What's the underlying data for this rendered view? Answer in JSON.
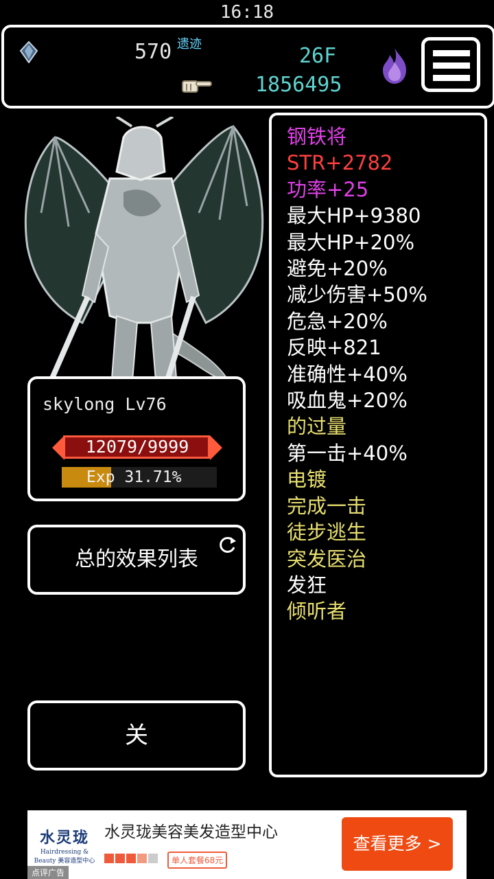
{
  "status_bar": {
    "time": "16:18"
  },
  "top_bar": {
    "gold": "570",
    "relic_label": "遗迹",
    "floor": "26F",
    "score": "1856495"
  },
  "character": {
    "name_level": "skylong Lv76",
    "hp_text": "12079/9999",
    "exp_text": "Exp 31.71%",
    "exp_fraction": 0.3171
  },
  "buttons": {
    "effects_list": "总的效果列表",
    "close": "关"
  },
  "stats": [
    {
      "text": "钢铁将",
      "color": "#e040e8"
    },
    {
      "text": "STR+2782",
      "color": "#ff4040"
    },
    {
      "text": "功率+25",
      "color": "#e040e8"
    },
    {
      "text": "最大HP+9380",
      "color": "#ffffff"
    },
    {
      "text": "最大HP+20%",
      "color": "#ffffff"
    },
    {
      "text": "避免+20%",
      "color": "#ffffff"
    },
    {
      "text": "减少伤害+50%",
      "color": "#ffffff"
    },
    {
      "text": "危急+20%",
      "color": "#ffffff"
    },
    {
      "text": "反映+821",
      "color": "#ffffff"
    },
    {
      "text": "准确性+40%",
      "color": "#ffffff"
    },
    {
      "text": "吸血鬼+20%",
      "color": "#ffffff"
    },
    {
      "text": "的过量",
      "color": "#e8e070"
    },
    {
      "text": "第一击+40%",
      "color": "#ffffff"
    },
    {
      "text": "电镀",
      "color": "#e8e070"
    },
    {
      "text": "完成一击",
      "color": "#e8e070"
    },
    {
      "text": "徒步逃生",
      "color": "#e8e070"
    },
    {
      "text": "突发医治",
      "color": "#e8e070"
    },
    {
      "text": "发狂",
      "color": "#ffffff"
    },
    {
      "text": "倾听者",
      "color": "#e8e070"
    }
  ],
  "ad": {
    "logo_main": "水灵珑",
    "logo_sub": "Hairdressing & Beauty 美容造型中心",
    "title": "水灵珑美容美发造型中心",
    "rating": 3.5,
    "tag": "单人套餐68元",
    "cta": "查看更多 >",
    "label": "点评广告"
  }
}
